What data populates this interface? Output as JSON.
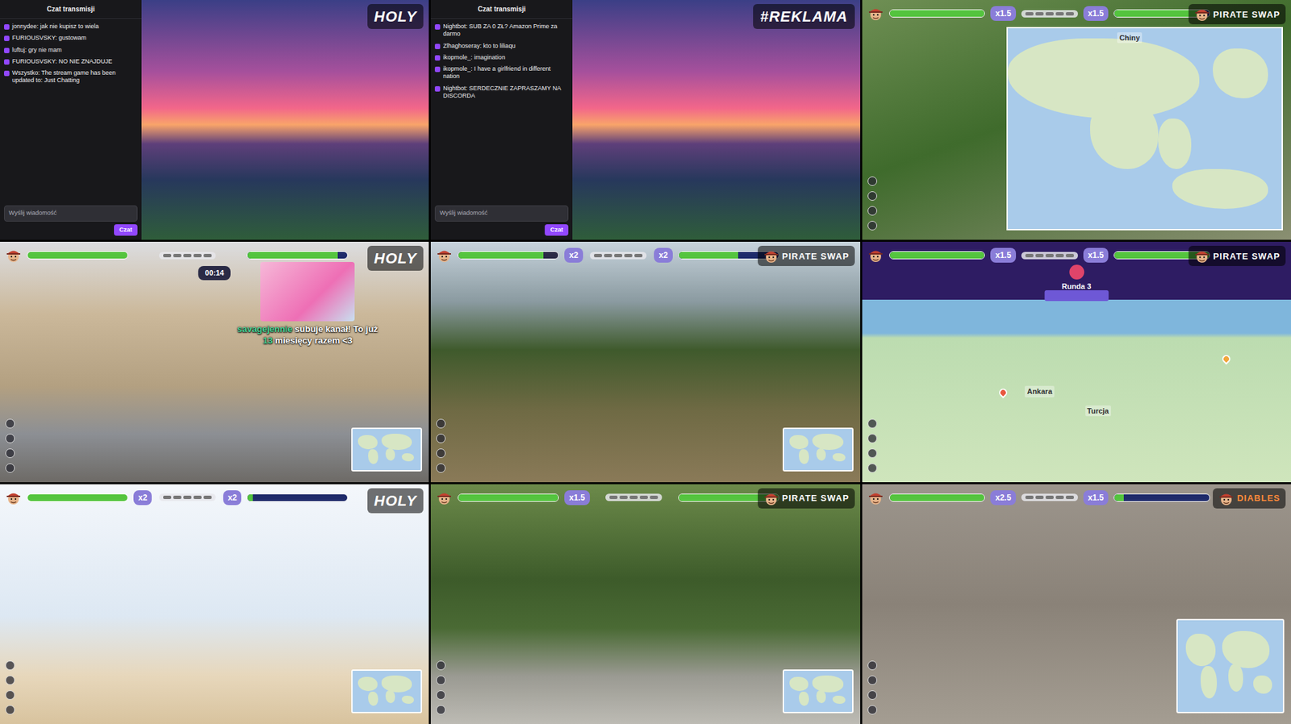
{
  "tiles": [
    {
      "kind": "chat",
      "logo": "HOLY",
      "chat": {
        "header": "Czat transmisji",
        "lines": [
          "jonnydee: jak nie kupisz to wiela",
          "FURIOUSVSKY: gustowam",
          "luftuj: gry nie mam",
          "FURIOUSVSKY: NO NIE ZNAJDUJE",
          "Wszystko: The stream game has been updated to: Just Chatting"
        ],
        "placeholder": "Wyślij wiadomość",
        "button": "Czat"
      }
    },
    {
      "kind": "chat",
      "logo": "#REKLAMA",
      "chat": {
        "header": "Czat transmisji",
        "lines": [
          "Nightbot: SUB ZA 0 ZŁ? Amazon Prime za darmo",
          "Zlhaghoseray: kto to liliaqu",
          "ikopmole_: imagination",
          "ikopmole_: I have a girlfriend in different nation",
          "Nightbot: SERDECZNIE ZAPRASZAMY NA DISCORDA"
        ],
        "placeholder": "Wyślij wiadomość",
        "button": "Czat"
      }
    },
    {
      "kind": "game",
      "hud": {
        "left_level": 1,
        "right_level": 0.95,
        "multipliers": [
          {
            "text": "x1.5",
            "side": "left"
          },
          {
            "text": "x1.5",
            "side": "right"
          }
        ],
        "logo": "PIRATE SWAP"
      },
      "map": {
        "kind": "panel",
        "labels": [
          "Chiny"
        ]
      }
    },
    {
      "kind": "game",
      "hud": {
        "left_level": 1,
        "right_level": 0.9,
        "multipliers": [],
        "logo": "HOLY"
      },
      "timer": "00:14",
      "alert": [
        {
          "text": "savagejennie",
          "highlight": true
        },
        {
          "text": " subuje kanał! To już ",
          "highlight": false
        },
        {
          "text": "13",
          "highlight": true
        },
        {
          "text": " miesięcy razem <3",
          "highlight": false
        }
      ],
      "map": {
        "kind": "mini",
        "labels": []
      }
    },
    {
      "kind": "game",
      "hud": {
        "left_level": 0.85,
        "right_level": 0.6,
        "multipliers": [
          {
            "text": "x2",
            "side": "left"
          },
          {
            "text": "x2",
            "side": "right"
          }
        ],
        "logo": "PIRATE SWAP"
      },
      "map": {
        "kind": "mini",
        "labels": []
      }
    },
    {
      "kind": "game",
      "hud": {
        "left_level": 1,
        "right_level": 1,
        "multipliers": [
          {
            "text": "x1.5",
            "side": "left"
          },
          {
            "text": "x1.5",
            "side": "right"
          }
        ],
        "logo": "PIRATE SWAP"
      },
      "round": "Runda 3",
      "map": {
        "kind": "full",
        "labels": [
          "Turcja",
          "Ankara"
        ]
      }
    },
    {
      "kind": "game",
      "hud": {
        "left_level": 1,
        "right_level": 0.05,
        "multipliers": [
          {
            "text": "x2",
            "side": "left"
          },
          {
            "text": "x2",
            "side": "right"
          }
        ],
        "logo": "HOLY"
      },
      "map": {
        "kind": "mini",
        "labels": []
      }
    },
    {
      "kind": "game",
      "hud": {
        "left_level": 1,
        "right_level": 1,
        "multipliers": [
          {
            "text": "x1.5",
            "side": "left"
          }
        ],
        "logo": "PIRATE SWAP"
      },
      "map": {
        "kind": "mini",
        "labels": []
      }
    },
    {
      "kind": "game",
      "hud": {
        "left_level": 1,
        "right_level": 0.1,
        "multipliers": [
          {
            "text": "x2.5",
            "side": "left"
          },
          {
            "text": "x1.5",
            "side": "right"
          }
        ],
        "logo": "DIABLES"
      },
      "map": {
        "kind": "mini-large",
        "labels": []
      }
    }
  ]
}
